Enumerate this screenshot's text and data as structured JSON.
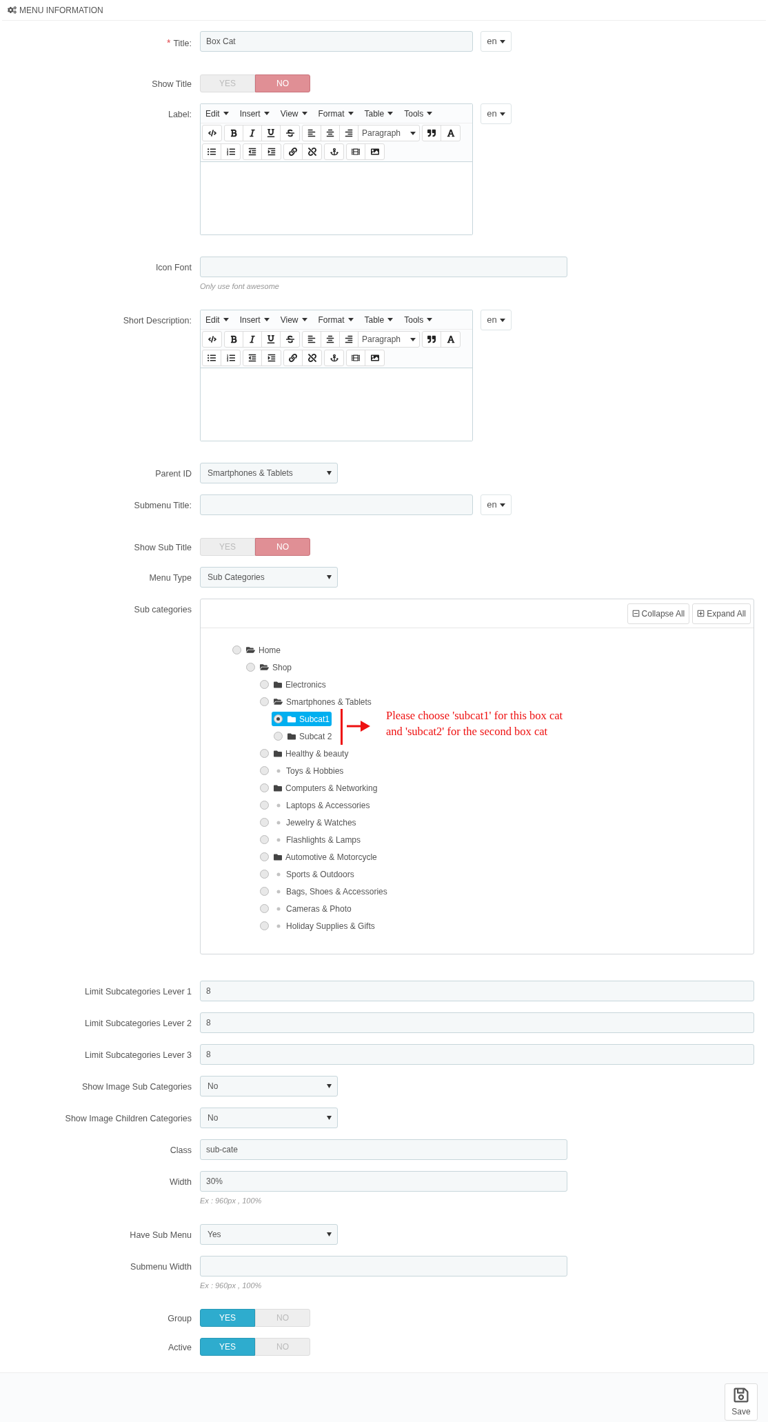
{
  "header": {
    "title": "MENU INFORMATION"
  },
  "fields": [
    {
      "kind": "text",
      "label": "Title:",
      "required_mark": "*",
      "value": "Box Cat",
      "lang": "en"
    },
    {
      "kind": "toggle",
      "label": "Show Title",
      "options": [
        {
          "label": "YES",
          "selected": false
        },
        {
          "label": "NO",
          "selected": true
        }
      ]
    },
    {
      "kind": "editor",
      "label": "Label:",
      "lang": "en",
      "menus": [
        "Edit",
        "Insert",
        "View",
        "Format",
        "Table",
        "Tools"
      ],
      "format_select": "Paragraph"
    },
    {
      "kind": "text",
      "label": "Icon Font",
      "help": "Only use font awesome"
    },
    {
      "kind": "editor",
      "label": "Short Description:",
      "lang": "en",
      "menus": [
        "Edit",
        "Insert",
        "View",
        "Format",
        "Table",
        "Tools"
      ],
      "format_select": "Paragraph"
    },
    {
      "kind": "select",
      "label": "Parent ID",
      "value": "Smartphones & Tablets"
    },
    {
      "kind": "text",
      "label": "Submenu Title:",
      "lang": "en"
    },
    {
      "kind": "toggle",
      "label": "Show Sub Title",
      "options": [
        {
          "label": "YES",
          "selected": false
        },
        {
          "label": "NO",
          "selected": true
        }
      ]
    },
    {
      "kind": "select",
      "label": "Menu Type",
      "value": "Sub Categories"
    },
    {
      "kind": "tree",
      "label": "Sub categories",
      "buttons": [
        {
          "kind": "collapse",
          "label": "Collapse All"
        },
        {
          "kind": "expand",
          "label": "Expand All"
        }
      ],
      "annotation": "Please choose 'subcat1' for this box cat\nand 'subcat2' for the second box cat",
      "nodes": [
        {
          "label": "Home",
          "kind": "open-folder",
          "selected": false,
          "children": [
            {
              "label": "Shop",
              "kind": "open-folder",
              "selected": false,
              "children": [
                {
                  "label": "Electronics",
                  "kind": "folder",
                  "selected": false
                },
                {
                  "label": "Smartphones & Tablets",
                  "kind": "open-folder",
                  "selected": false,
                  "children": [
                    {
                      "label": "Subcat1",
                      "kind": "folder",
                      "selected": true
                    },
                    {
                      "label": "Subcat 2",
                      "kind": "folder",
                      "selected": false
                    }
                  ]
                },
                {
                  "label": "Healthy & beauty",
                  "kind": "folder",
                  "selected": false
                },
                {
                  "label": "Toys & Hobbies",
                  "kind": "leaf",
                  "selected": false
                },
                {
                  "label": "Computers & Networking",
                  "kind": "folder",
                  "selected": false
                },
                {
                  "label": "Laptops & Accessories",
                  "kind": "leaf",
                  "selected": false
                },
                {
                  "label": "Jewelry & Watches",
                  "kind": "leaf",
                  "selected": false
                },
                {
                  "label": "Flashlights & Lamps",
                  "kind": "leaf",
                  "selected": false
                },
                {
                  "label": "Automotive & Motorcycle",
                  "kind": "folder",
                  "selected": false
                },
                {
                  "label": "Sports & Outdoors",
                  "kind": "leaf",
                  "selected": false
                },
                {
                  "label": "Bags, Shoes & Accessories",
                  "kind": "leaf",
                  "selected": false
                },
                {
                  "label": "Cameras & Photo",
                  "kind": "leaf",
                  "selected": false
                },
                {
                  "label": "Holiday Supplies & Gifts",
                  "kind": "leaf",
                  "selected": false
                }
              ]
            }
          ]
        }
      ]
    },
    {
      "kind": "number",
      "label": "Limit Subcategories Lever 1",
      "value": "8"
    },
    {
      "kind": "number",
      "label": "Limit Subcategories Lever 2",
      "value": "8"
    },
    {
      "kind": "number",
      "label": "Limit Subcategories Lever 3",
      "value": "8"
    },
    {
      "kind": "select",
      "label": "Show Image Sub Categories",
      "value": "No"
    },
    {
      "kind": "select",
      "label": "Show Image Children Categories",
      "value": "No"
    },
    {
      "kind": "text",
      "label": "Class",
      "value": "sub-cate"
    },
    {
      "kind": "text",
      "label": "Width",
      "value": "30%",
      "help": "Ex : 960px , 100%"
    },
    {
      "kind": "select",
      "label": "Have Sub Menu",
      "value": "Yes"
    },
    {
      "kind": "text",
      "label": "Submenu Width",
      "help": "Ex : 960px , 100%"
    },
    {
      "kind": "toggle",
      "label": "Group",
      "options": [
        {
          "label": "YES",
          "selected": true
        },
        {
          "label": "NO",
          "selected": false
        }
      ]
    },
    {
      "kind": "toggle",
      "label": "Active",
      "options": [
        {
          "label": "YES",
          "selected": true
        },
        {
          "label": "NO",
          "selected": false
        }
      ]
    }
  ],
  "footer": {
    "save_label": "Save"
  }
}
